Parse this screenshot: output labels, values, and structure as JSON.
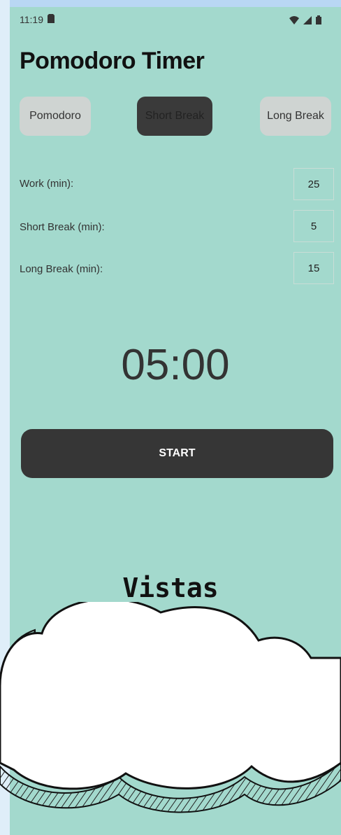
{
  "status_bar": {
    "time": "11:19",
    "icons": [
      "sim-icon",
      "wifi-icon",
      "signal-icon",
      "battery-icon"
    ]
  },
  "app": {
    "title": "Pomodoro Timer",
    "modes": [
      {
        "label": "Pomodoro",
        "selected": false
      },
      {
        "label": "Short Break",
        "selected": true
      },
      {
        "label": "Long Break",
        "selected": false
      }
    ],
    "settings": [
      {
        "label": "Work (min):",
        "value": "25"
      },
      {
        "label": "Short Break (min):",
        "value": "5"
      },
      {
        "label": "Long Break (min):",
        "value": "15"
      }
    ],
    "timer": "05:00",
    "start_label": "START"
  },
  "overlay": {
    "cloud_text": "Vistas"
  },
  "colors": {
    "background": "#a3d9cd",
    "dark_button": "#363636",
    "light_button": "#cfd4d2"
  }
}
